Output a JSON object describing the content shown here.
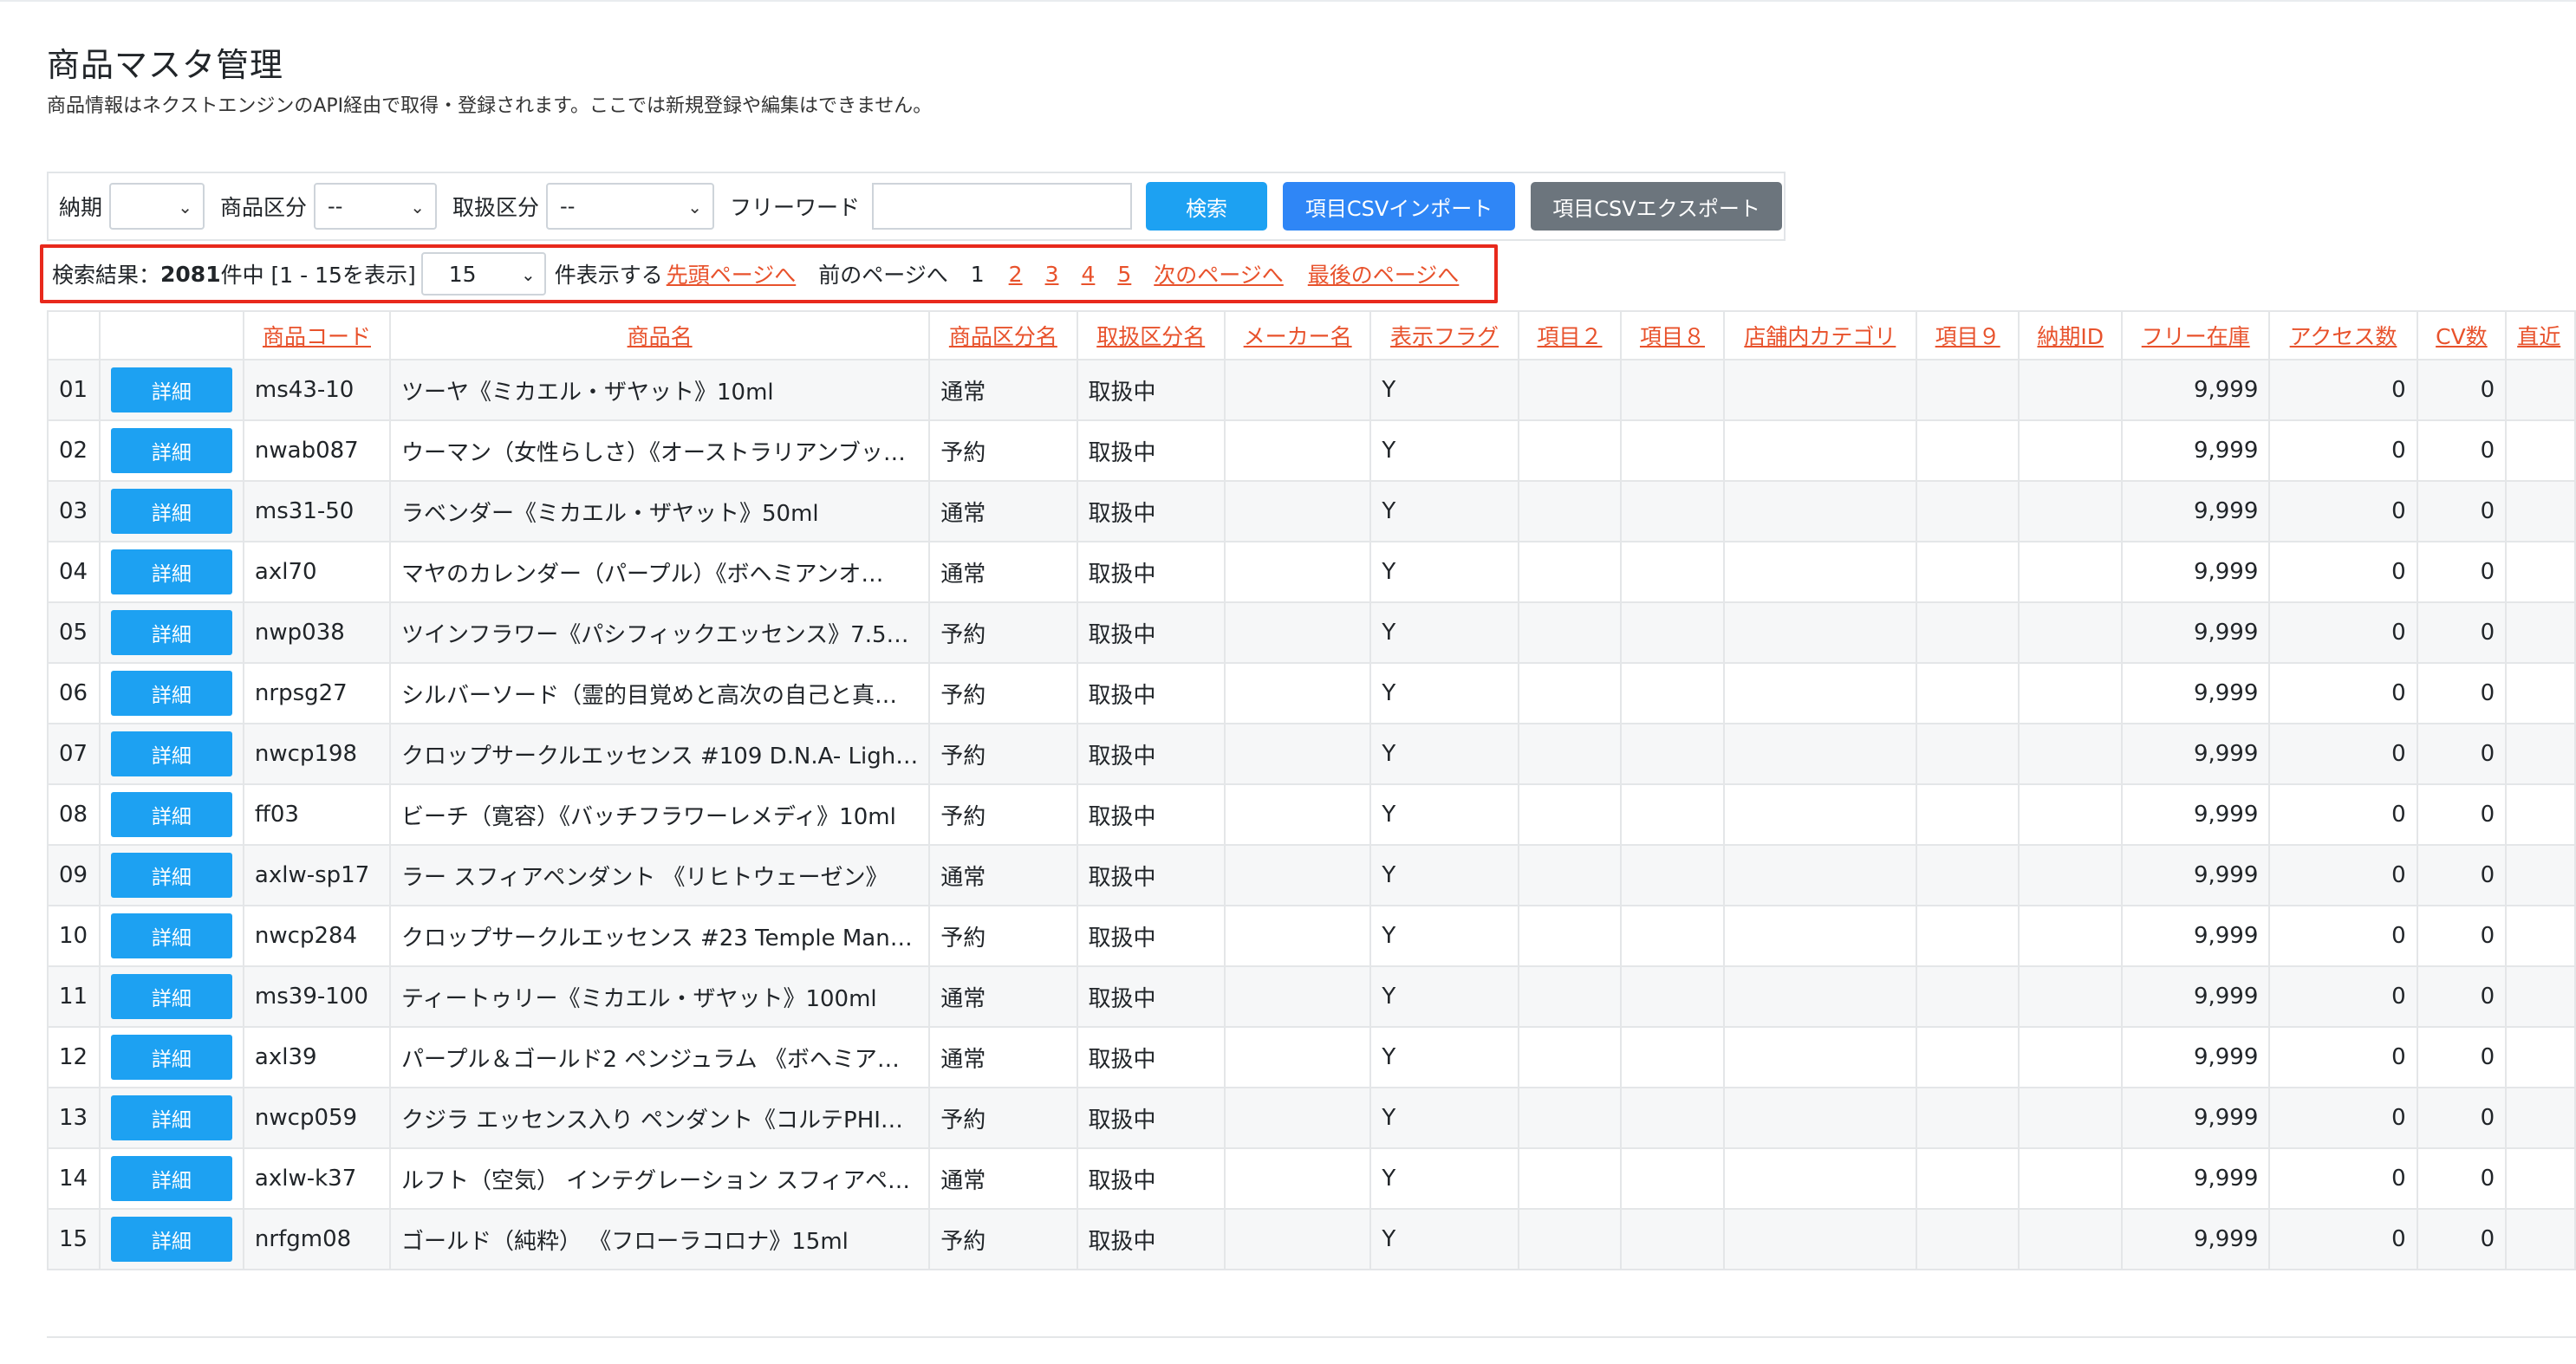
{
  "page": {
    "title": "商品マスタ管理",
    "description": "商品情報はネクストエンジンのAPI経由で取得・登録されます。ここでは新規登録や編集はできません。"
  },
  "search": {
    "delivery_label": "納期",
    "delivery_value": "",
    "category_label": "商品区分",
    "category_value": "--",
    "handling_label": "取扱区分",
    "handling_value": "--",
    "freeword_label": "フリーワード",
    "freeword_value": "",
    "search_button": "検索",
    "import_button": "項目CSVインポート",
    "export_button": "項目CSVエクスポート"
  },
  "pager": {
    "result_prefix": "検索結果：",
    "total": "2081",
    "result_suffix": "件中 [1 - 15を表示]",
    "per_page": "15",
    "per_page_suffix": "件表示する",
    "first": "先頭ページへ",
    "prev": "前のページへ",
    "pages": [
      "1",
      "2",
      "3",
      "4",
      "5"
    ],
    "next": "次のページへ",
    "last": "最後のページへ"
  },
  "table": {
    "headers": [
      "商品コード",
      "商品名",
      "商品区分名",
      "取扱区分名",
      "メーカー名",
      "表示フラグ",
      "項目２",
      "項目８",
      "店舗内カテゴリ",
      "項目９",
      "納期ID",
      "フリー在庫",
      "アクセス数",
      "CV数",
      "直近"
    ],
    "detail_label": "詳細",
    "rows": [
      {
        "no": "01",
        "code": "ms43-10",
        "name": "ツーヤ《ミカエル・ザヤット》10ml",
        "category": "通常",
        "handling": "取扱中",
        "flag": "Y",
        "stock": "9,999",
        "access": "0",
        "cv": "0"
      },
      {
        "no": "02",
        "code": "nwab087",
        "name": "ウーマン（女性らしさ）《オーストラリアンブッ…",
        "category": "予約",
        "handling": "取扱中",
        "flag": "Y",
        "stock": "9,999",
        "access": "0",
        "cv": "0"
      },
      {
        "no": "03",
        "code": "ms31-50",
        "name": "ラベンダー《ミカエル・ザヤット》50ml",
        "category": "通常",
        "handling": "取扱中",
        "flag": "Y",
        "stock": "9,999",
        "access": "0",
        "cv": "0"
      },
      {
        "no": "04",
        "code": "axl70",
        "name": "マヤのカレンダー（パープル）《ボヘミアンオ…",
        "category": "通常",
        "handling": "取扱中",
        "flag": "Y",
        "stock": "9,999",
        "access": "0",
        "cv": "0"
      },
      {
        "no": "05",
        "code": "nwp038",
        "name": "ツインフラワー《パシフィックエッセンス》7.5…",
        "category": "予約",
        "handling": "取扱中",
        "flag": "Y",
        "stock": "9,999",
        "access": "0",
        "cv": "0"
      },
      {
        "no": "06",
        "code": "nrpsg27",
        "name": "シルバーソード（霊的目覚めと高次の自己と真…",
        "category": "予約",
        "handling": "取扱中",
        "flag": "Y",
        "stock": "9,999",
        "access": "0",
        "cv": "0"
      },
      {
        "no": "07",
        "code": "nwcp198",
        "name": "クロップサークルエッセンス #109 D.N.A- Ligh…",
        "category": "予約",
        "handling": "取扱中",
        "flag": "Y",
        "stock": "9,999",
        "access": "0",
        "cv": "0"
      },
      {
        "no": "08",
        "code": "ff03",
        "name": "ビーチ（寛容）《バッチフラワーレメディ》10ml",
        "category": "予約",
        "handling": "取扱中",
        "flag": "Y",
        "stock": "9,999",
        "access": "0",
        "cv": "0"
      },
      {
        "no": "09",
        "code": "axlw-sp17",
        "name": "ラー スフィアペンダント 《リヒトウェーゼン》",
        "category": "通常",
        "handling": "取扱中",
        "flag": "Y",
        "stock": "9,999",
        "access": "0",
        "cv": "0"
      },
      {
        "no": "10",
        "code": "nwcp284",
        "name": "クロップサークルエッセンス #23 Temple Man…",
        "category": "予約",
        "handling": "取扱中",
        "flag": "Y",
        "stock": "9,999",
        "access": "0",
        "cv": "0"
      },
      {
        "no": "11",
        "code": "ms39-100",
        "name": "ティートゥリー《ミカエル・ザヤット》100ml",
        "category": "通常",
        "handling": "取扱中",
        "flag": "Y",
        "stock": "9,999",
        "access": "0",
        "cv": "0"
      },
      {
        "no": "12",
        "code": "axl39",
        "name": "パープル＆ゴールド2 ペンジュラム 《ボヘミア…",
        "category": "通常",
        "handling": "取扱中",
        "flag": "Y",
        "stock": "9,999",
        "access": "0",
        "cv": "0"
      },
      {
        "no": "13",
        "code": "nwcp059",
        "name": "クジラ エッセンス入り ペンダント《コルテPHI…",
        "category": "予約",
        "handling": "取扱中",
        "flag": "Y",
        "stock": "9,999",
        "access": "0",
        "cv": "0"
      },
      {
        "no": "14",
        "code": "axlw-k37",
        "name": "ルフト（空気） インテグレーション スフィアペ…",
        "category": "通常",
        "handling": "取扱中",
        "flag": "Y",
        "stock": "9,999",
        "access": "0",
        "cv": "0"
      },
      {
        "no": "15",
        "code": "nrfgm08",
        "name": "ゴールド（純粋） 《フローラコロナ》15ml",
        "category": "予約",
        "handling": "取扱中",
        "flag": "Y",
        "stock": "9,999",
        "access": "0",
        "cv": "0"
      }
    ]
  },
  "colors": {
    "accent_link": "#e8522c",
    "primary_button": "#1da1f2",
    "import_button": "#2f86f6",
    "export_button": "#6c757d",
    "highlight_border": "#e8291c"
  }
}
